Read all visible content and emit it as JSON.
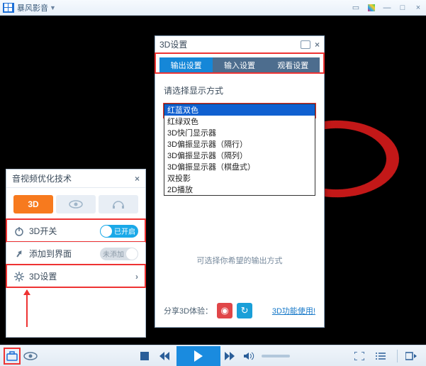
{
  "titlebar": {
    "app_name": "暴风影音"
  },
  "av_panel": {
    "title": "音视频优化技术",
    "modes": {
      "three_d": "3D"
    },
    "rows": {
      "switch_label": "3D开关",
      "switch_on": "已开启",
      "add_label": "添加到界面",
      "add_off": "未添加",
      "settings_label": "3D设置"
    }
  },
  "p3d": {
    "title": "3D设置",
    "tabs": [
      "输出设置",
      "输入设置",
      "观看设置"
    ],
    "select_label": "请选择显示方式",
    "combo_value": "红蓝双色",
    "options": [
      "红蓝双色",
      "红绿双色",
      "3D快门显示器",
      "3D偏振显示器（隔行）",
      "3D偏振显示器（隔列）",
      "3D偏振显示器（棋盘式）",
      "双投影",
      "2D播放"
    ],
    "hint": "可选择你希望的输出方式",
    "share_label": "分享3D体验：",
    "link": "3D功能使用!"
  }
}
